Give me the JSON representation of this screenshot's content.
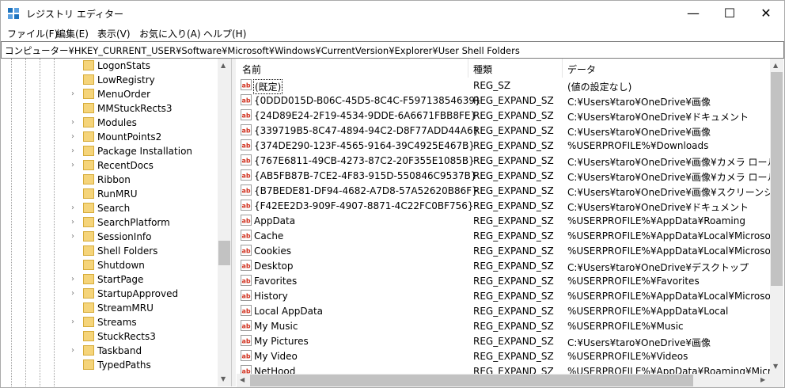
{
  "window": {
    "title": "レジストリ エディター",
    "minimize": "—",
    "maximize": "☐",
    "close": "✕"
  },
  "menu": [
    "ファイル(F)",
    "編集(E)",
    "表示(V)",
    "お気に入り(A)",
    "ヘルプ(H)"
  ],
  "address": "コンピューター¥HKEY_CURRENT_USER¥Software¥Microsoft¥Windows¥CurrentVersion¥Explorer¥User Shell Folders",
  "tree": [
    {
      "label": "LogonStats",
      "expandable": false
    },
    {
      "label": "LowRegistry",
      "expandable": false
    },
    {
      "label": "MenuOrder",
      "expandable": true
    },
    {
      "label": "MMStuckRects3",
      "expandable": false
    },
    {
      "label": "Modules",
      "expandable": true
    },
    {
      "label": "MountPoints2",
      "expandable": true
    },
    {
      "label": "Package Installation",
      "expandable": true
    },
    {
      "label": "RecentDocs",
      "expandable": true
    },
    {
      "label": "Ribbon",
      "expandable": false
    },
    {
      "label": "RunMRU",
      "expandable": false
    },
    {
      "label": "Search",
      "expandable": true
    },
    {
      "label": "SearchPlatform",
      "expandable": true
    },
    {
      "label": "SessionInfo",
      "expandable": true
    },
    {
      "label": "Shell Folders",
      "expandable": false
    },
    {
      "label": "Shutdown",
      "expandable": false
    },
    {
      "label": "StartPage",
      "expandable": true
    },
    {
      "label": "StartupApproved",
      "expandable": true
    },
    {
      "label": "StreamMRU",
      "expandable": false
    },
    {
      "label": "Streams",
      "expandable": true
    },
    {
      "label": "StuckRects3",
      "expandable": false
    },
    {
      "label": "Taskband",
      "expandable": true
    },
    {
      "label": "TypedPaths",
      "expandable": false
    }
  ],
  "columns": {
    "name": "名前",
    "type": "種類",
    "data": "データ"
  },
  "values": [
    {
      "name": "(既定)",
      "type": "REG_SZ",
      "data": "(値の設定なし)"
    },
    {
      "name": "{0DDD015D-B06C-45D5-8C4C-F59713854639}",
      "type": "REG_EXPAND_SZ",
      "data": "C:¥Users¥taro¥OneDrive¥画像"
    },
    {
      "name": "{24D89E24-2F19-4534-9DDE-6A6671FBB8FE}",
      "type": "REG_EXPAND_SZ",
      "data": "C:¥Users¥taro¥OneDrive¥ドキュメント"
    },
    {
      "name": "{339719B5-8C47-4894-94C2-D8F77ADD44A6}",
      "type": "REG_EXPAND_SZ",
      "data": "C:¥Users¥taro¥OneDrive¥画像"
    },
    {
      "name": "{374DE290-123F-4565-9164-39C4925E467B}",
      "type": "REG_EXPAND_SZ",
      "data": "%USERPROFILE%¥Downloads"
    },
    {
      "name": "{767E6811-49CB-4273-87C2-20F355E1085B}",
      "type": "REG_EXPAND_SZ",
      "data": "C:¥Users¥taro¥OneDrive¥画像¥カメラ ロール"
    },
    {
      "name": "{AB5FB87B-7CE2-4F83-915D-550846C9537B}",
      "type": "REG_EXPAND_SZ",
      "data": "C:¥Users¥taro¥OneDrive¥画像¥カメラ ロール"
    },
    {
      "name": "{B7BEDE81-DF94-4682-A7D8-57A52620B86F}",
      "type": "REG_EXPAND_SZ",
      "data": "C:¥Users¥taro¥OneDrive¥画像¥スクリーンショット"
    },
    {
      "name": "{F42EE2D3-909F-4907-8871-4C22FC0BF756}",
      "type": "REG_EXPAND_SZ",
      "data": "C:¥Users¥taro¥OneDrive¥ドキュメント"
    },
    {
      "name": "AppData",
      "type": "REG_EXPAND_SZ",
      "data": "%USERPROFILE%¥AppData¥Roaming"
    },
    {
      "name": "Cache",
      "type": "REG_EXPAND_SZ",
      "data": "%USERPROFILE%¥AppData¥Local¥Microsoft¥Wi"
    },
    {
      "name": "Cookies",
      "type": "REG_EXPAND_SZ",
      "data": "%USERPROFILE%¥AppData¥Local¥Microsoft¥Wi"
    },
    {
      "name": "Desktop",
      "type": "REG_EXPAND_SZ",
      "data": "C:¥Users¥taro¥OneDrive¥デスクトップ"
    },
    {
      "name": "Favorites",
      "type": "REG_EXPAND_SZ",
      "data": "%USERPROFILE%¥Favorites"
    },
    {
      "name": "History",
      "type": "REG_EXPAND_SZ",
      "data": "%USERPROFILE%¥AppData¥Local¥Microsoft¥Wi"
    },
    {
      "name": "Local AppData",
      "type": "REG_EXPAND_SZ",
      "data": "%USERPROFILE%¥AppData¥Local"
    },
    {
      "name": "My Music",
      "type": "REG_EXPAND_SZ",
      "data": "%USERPROFILE%¥Music"
    },
    {
      "name": "My Pictures",
      "type": "REG_EXPAND_SZ",
      "data": "C:¥Users¥taro¥OneDrive¥画像"
    },
    {
      "name": "My Video",
      "type": "REG_EXPAND_SZ",
      "data": "%USERPROFILE%¥Videos"
    },
    {
      "name": "NetHood",
      "type": "REG_EXPAND_SZ",
      "data": "%USERPROFILE%¥AppData¥Roaming¥Microsoft"
    }
  ]
}
